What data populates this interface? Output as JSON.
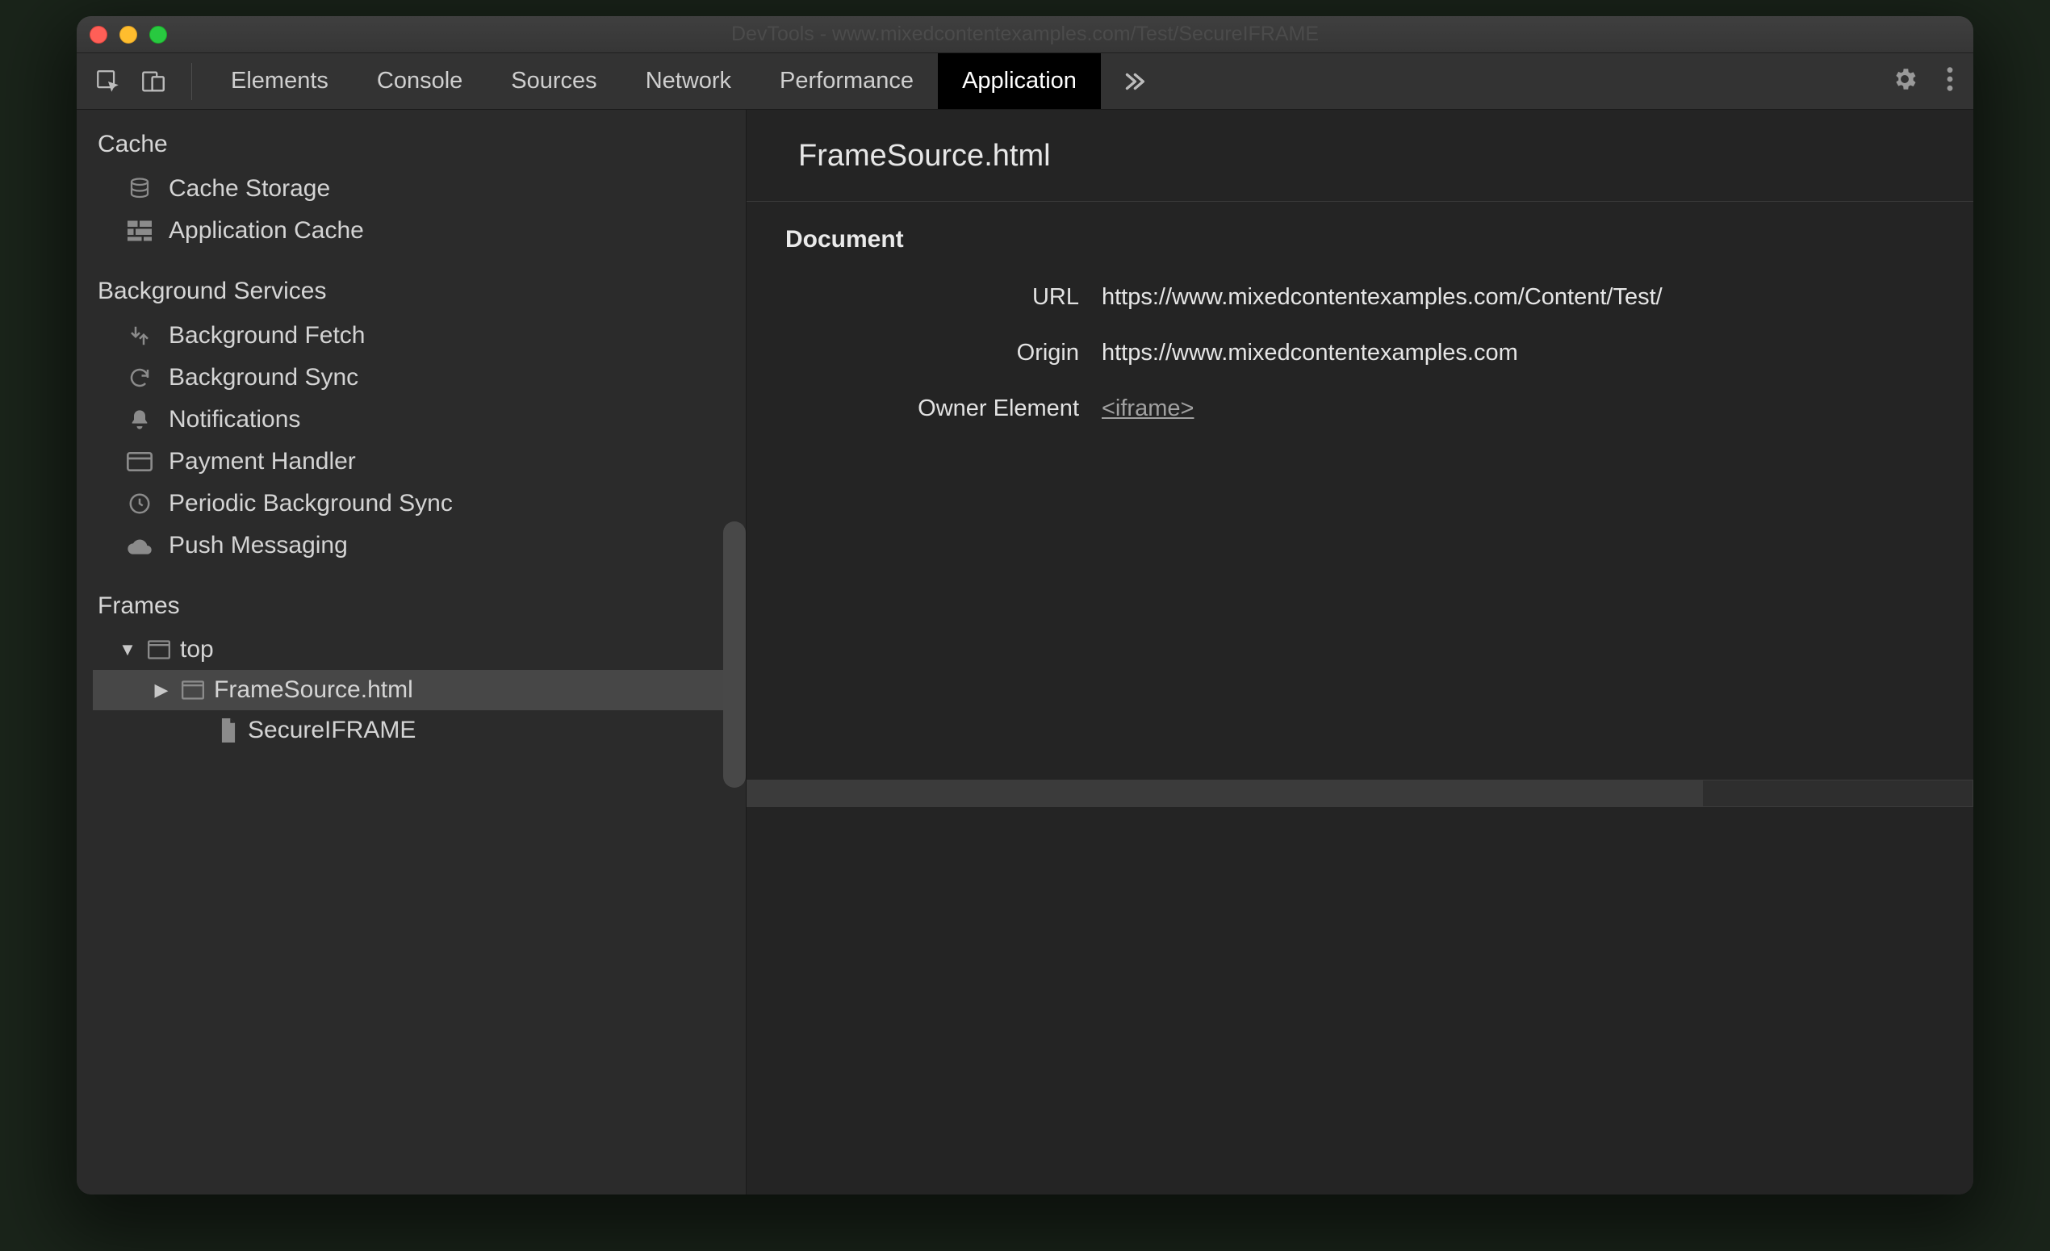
{
  "window": {
    "title": "DevTools - www.mixedcontentexamples.com/Test/SecureIFRAME"
  },
  "tabs": {
    "items": [
      "Elements",
      "Console",
      "Sources",
      "Network",
      "Performance",
      "Application"
    ],
    "active": "Application"
  },
  "sidebar": {
    "cache_heading": "Cache",
    "cache_items": [
      {
        "label": "Cache Storage",
        "icon": "database-icon"
      },
      {
        "label": "Application Cache",
        "icon": "grid-icon"
      }
    ],
    "bg_heading": "Background Services",
    "bg_items": [
      {
        "label": "Background Fetch",
        "icon": "fetch-icon"
      },
      {
        "label": "Background Sync",
        "icon": "sync-icon"
      },
      {
        "label": "Notifications",
        "icon": "bell-icon"
      },
      {
        "label": "Payment Handler",
        "icon": "card-icon"
      },
      {
        "label": "Periodic Background Sync",
        "icon": "clock-icon"
      },
      {
        "label": "Push Messaging",
        "icon": "cloud-icon"
      }
    ],
    "frames_heading": "Frames",
    "frames_tree": {
      "top_label": "top",
      "child_label": "FrameSource.html",
      "doc_label": "SecureIFRAME"
    }
  },
  "detail": {
    "title": "FrameSource.html",
    "section": "Document",
    "rows": {
      "url_label": "URL",
      "url_value": "https://www.mixedcontentexamples.com/Content/Test/",
      "origin_label": "Origin",
      "origin_value": "https://www.mixedcontentexamples.com",
      "owner_label": "Owner Element",
      "owner_value": "<iframe>"
    }
  }
}
